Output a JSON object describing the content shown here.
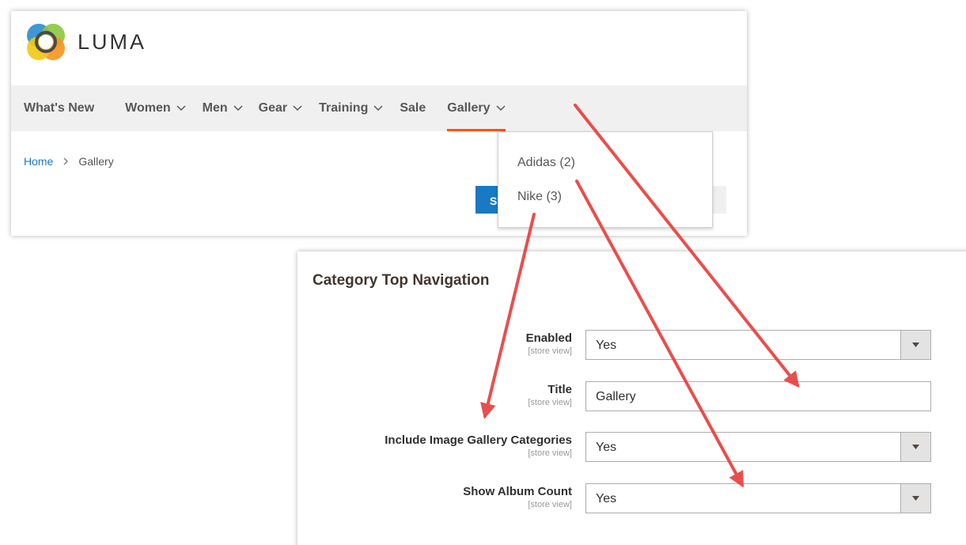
{
  "store": {
    "logo_text": "LUMA",
    "nav": [
      {
        "label": "What's New",
        "has_chevron": false
      },
      {
        "label": "Women",
        "has_chevron": true
      },
      {
        "label": "Men",
        "has_chevron": true
      },
      {
        "label": "Gear",
        "has_chevron": true
      },
      {
        "label": "Training",
        "has_chevron": true
      },
      {
        "label": "Sale",
        "has_chevron": false
      },
      {
        "label": "Gallery",
        "has_chevron": true,
        "active": true
      }
    ],
    "breadcrumb": {
      "home": "Home",
      "current": "Gallery"
    },
    "button_partial_label": "S",
    "dropdown": [
      "Adidas (2)",
      "Nike (3)"
    ]
  },
  "admin": {
    "section_title": "Category Top Navigation",
    "fields": [
      {
        "label": "Enabled",
        "scope": "[store view]",
        "type": "select",
        "value": "Yes"
      },
      {
        "label": "Title",
        "scope": "[store view]",
        "type": "text",
        "value": "Gallery"
      },
      {
        "label": "Include Image Gallery Categories",
        "scope": "[store view]",
        "type": "select",
        "value": "Yes"
      },
      {
        "label": "Show Album Count",
        "scope": "[store view]",
        "type": "select",
        "value": "Yes"
      }
    ]
  },
  "colors": {
    "accent_underline": "#ff5501",
    "link": "#1979c3",
    "annotation_arrow": "#e84040"
  },
  "icons": [
    "luma-logo-icon",
    "chevron-down-icon",
    "chevron-right-icon",
    "select-arrow-icon"
  ]
}
